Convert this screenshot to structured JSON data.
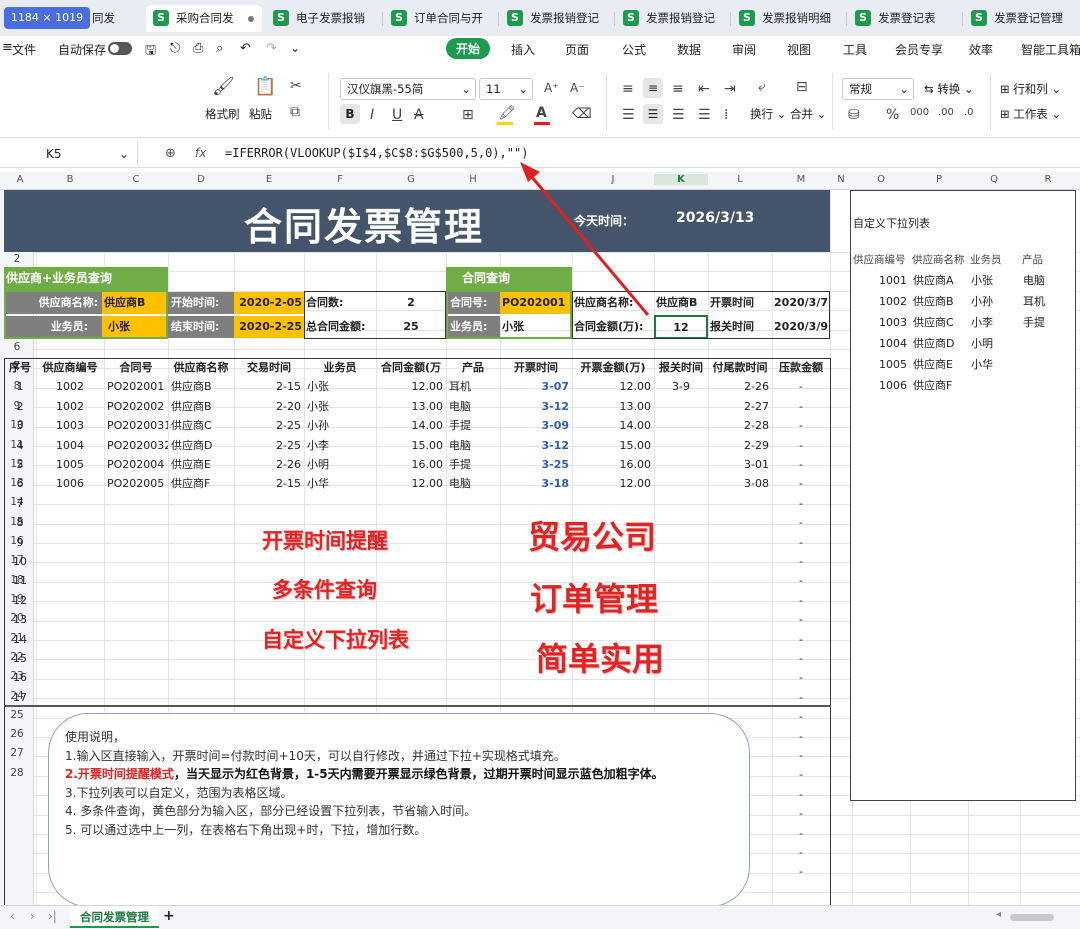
{
  "tabs": {
    "size_label": "1184 × 1019",
    "items": [
      "同发",
      "采购合同发",
      "电子发票报销",
      "订单合同与开",
      "发票报销登记",
      "发票报销登记",
      "发票报销明细",
      "发票登记表",
      "发票登记管理"
    ]
  },
  "menu": {
    "file": "文件",
    "autosave": "自动保存",
    "tabs": [
      "开始",
      "插入",
      "页面",
      "公式",
      "数据",
      "审阅",
      "视图",
      "工具",
      "会员专享",
      "效率",
      "智能工具箱"
    ]
  },
  "toolbar": {
    "format_painter": "格式刷",
    "paste": "粘贴",
    "font": "汉仪旗黑-55简",
    "size": "11",
    "number_format": "常规",
    "convert": "转换",
    "rows_cols": "行和列",
    "wrap": "换行",
    "merge": "合并",
    "sheet": "工作表"
  },
  "formula": {
    "cell": "K5",
    "fx": "fx",
    "text": "=IFERROR(VLOOKUP($I$4,$C$8:$G$500,5,0),\"\")"
  },
  "columns": [
    "A",
    "B",
    "C",
    "D",
    "E",
    "F",
    "G",
    "H",
    "J",
    "K",
    "L",
    "M",
    "N",
    "O",
    "P",
    "Q",
    "R"
  ],
  "rows": [
    "1",
    "2",
    "3",
    "4",
    "5",
    "6",
    "7",
    "8",
    "9",
    "10",
    "11",
    "12",
    "13",
    "14",
    "15",
    "16",
    "17",
    "18",
    "19",
    "20",
    "21",
    "22",
    "23",
    "24",
    "25",
    "26",
    "27",
    "28"
  ],
  "sheet": {
    "title": "合同发票管理",
    "today_label": "今天时间：",
    "today": "2026/3/13",
    "q1_header": "供应商+业务员查询",
    "q2_header": "合同查询",
    "r4": {
      "supplier_label": "供应商名称:",
      "supplier": "供应商B",
      "start_label": "开始时间:",
      "start": "2020-2-05",
      "count_label": "合同数:",
      "count": "2",
      "contract_label": "合同号:",
      "contract": "PO202001",
      "sup2_label": "供应商名称:",
      "sup2": "供应商B",
      "open_label": "开票时间",
      "open": "2020/3/7"
    },
    "r5": {
      "sales_label": "业务员:",
      "sales": "小张",
      "end_label": "结束时间:",
      "end": "2020-2-25",
      "amt_label": "总合同金额:",
      "amt": "25",
      "sales2_label": "业务员:",
      "sales2": "小张",
      "amt2_label": "合同金额(万):",
      "amt2": "12",
      "report_label": "报关时间",
      "report": "2020/3/9"
    },
    "headers": [
      "序号",
      "供应商编号",
      "合同号",
      "供应商名称",
      "交易时间",
      "业务员",
      "合同金额(万",
      "产品",
      "开票时间",
      "开票金额(万)",
      "报关时间",
      "付尾款时间",
      "压款金额"
    ],
    "data": [
      [
        "1",
        "1002",
        "PO202001",
        "供应商B",
        "2-15",
        "小张",
        "12.00",
        "耳机",
        "3-07",
        "12.00",
        "3-9",
        "2-26",
        "-"
      ],
      [
        "2",
        "1002",
        "PO202002",
        "供应商B",
        "2-20",
        "小张",
        "13.00",
        "电脑",
        "3-12",
        "13.00",
        "",
        "2-27",
        "-"
      ],
      [
        "3",
        "1003",
        "PO2020031",
        "供应商C",
        "2-25",
        "小孙",
        "14.00",
        "手提",
        "3-09",
        "14.00",
        "",
        "2-28",
        "-"
      ],
      [
        "4",
        "1004",
        "PO2020032",
        "供应商D",
        "2-25",
        "小李",
        "15.00",
        "电脑",
        "3-12",
        "15.00",
        "",
        "2-29",
        "-"
      ],
      [
        "5",
        "1005",
        "PO202004",
        "供应商E",
        "2-26",
        "小明",
        "16.00",
        "手提",
        "3-25",
        "16.00",
        "",
        "3-01",
        "-"
      ],
      [
        "6",
        "1006",
        "PO202005",
        "供应商F",
        "2-15",
        "小华",
        "12.00",
        "电脑",
        "3-18",
        "12.00",
        "",
        "3-08",
        "-"
      ]
    ],
    "seq_more": [
      "7",
      "8",
      "9",
      "10",
      "11",
      "12",
      "13",
      "14",
      "15",
      "16",
      "17"
    ],
    "dash": "-",
    "promo": [
      "开票时间提醒",
      "多条件查询",
      "自定义下拉列表",
      "贸易公司",
      "订单管理",
      "简单实用"
    ]
  },
  "panel": {
    "title": "自定义下拉列表",
    "headers": [
      "供应商编号",
      "供应商名称",
      "业务员",
      "产品"
    ],
    "rows": [
      [
        "1001",
        "供应商A",
        "小张",
        "电脑"
      ],
      [
        "1002",
        "供应商B",
        "小孙",
        "耳机"
      ],
      [
        "1003",
        "供应商C",
        "小李",
        "手提"
      ],
      [
        "1004",
        "供应商D",
        "小明",
        ""
      ],
      [
        "1005",
        "供应商E",
        "小华",
        ""
      ],
      [
        "1006",
        "供应商F",
        "",
        ""
      ]
    ]
  },
  "notes": {
    "l0": "使用说明，",
    "l1": "1.输入区直接输入，开票时间=付款时间+10天，可以自行修改，并通过下拉+实现格式填充。",
    "l2a": "2.",
    "l2b": "开票时间提醒模式",
    "l2c": "，当天显示为红色背景，1-5天内需要开票显示绿色背景，过期开票时间显示蓝色加粗字体。",
    "l3": "3.下拉列表可以自定义，范围为表格区域。",
    "l4": "4. 多条件查询，黄色部分为输入区，部分已经设置下拉列表，节省输入时间。",
    "l5": "5. 可以通过选中上一列，在表格右下角出现+时，下拉，增加行数。"
  },
  "sheettab": {
    "name": "合同发票管理",
    "add": "+"
  },
  "colors": {
    "title_bg": "#44546a",
    "green_header": "#70ad47",
    "yellow": "#ffc000",
    "gray_label": "#7f7f7f",
    "blue_date": "#2e5fb4",
    "accent": "#1c9a4e"
  }
}
